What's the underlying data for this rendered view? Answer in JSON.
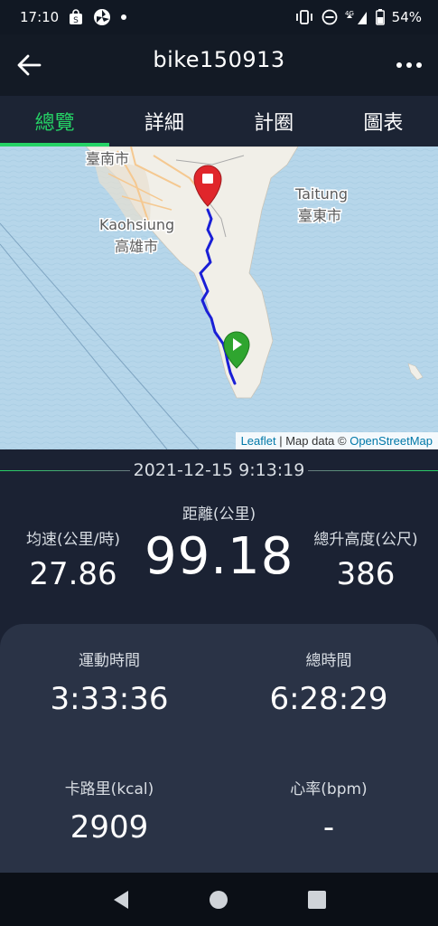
{
  "status_bar": {
    "time": "17:10",
    "network": "4G",
    "battery": "54%",
    "icons": [
      "shopping-bag-icon",
      "pinwheel-icon",
      "dot-icon",
      "vibrate-icon",
      "do-not-disturb-icon",
      "signal-icon",
      "battery-icon"
    ]
  },
  "header": {
    "title": "bike150913",
    "back_icon": "arrow-left-icon",
    "more_icon": "more-dots-icon"
  },
  "tabs": [
    {
      "label": "總覽",
      "active": true
    },
    {
      "label": "詳細",
      "active": false
    },
    {
      "label": "計圈",
      "active": false
    },
    {
      "label": "圖表",
      "active": false
    }
  ],
  "map": {
    "labels": {
      "tainan": "臺南市",
      "kaohsiung_en": "Kaohsiung",
      "kaohsiung_zh": "高雄市",
      "taitung_en": "Taitung",
      "taitung_zh": "臺東市"
    },
    "attribution": {
      "leaflet": "Leaflet",
      "separator": " | Map data © ",
      "osm": "OpenStreetMap"
    },
    "route_color": "#1a1fd6",
    "end_marker_color": "#e0262b",
    "start_marker_color": "#2fa52f"
  },
  "summary": {
    "datetime": "2021-12-15 9:13:19",
    "avg_speed": {
      "label": "均速(公里/時)",
      "value": "27.86"
    },
    "distance": {
      "label": "距離(公里)",
      "value": "99.18"
    },
    "elevation_gain": {
      "label": "總升高度(公尺)",
      "value": "386"
    }
  },
  "details": {
    "moving_time": {
      "label": "運動時間",
      "value": "3:33:36"
    },
    "total_time": {
      "label": "總時間",
      "value": "6:28:29"
    },
    "calories": {
      "label": "卡路里(kcal)",
      "value": "2909"
    },
    "heart_rate": {
      "label": "心率(bpm)",
      "value": "-"
    }
  },
  "nav": {
    "back_icon": "triangle-back-icon",
    "home_icon": "circle-home-icon",
    "recents_icon": "square-recents-icon"
  },
  "colors": {
    "accent": "#25d366",
    "background": "#1b2233",
    "card": "#2a3346"
  }
}
